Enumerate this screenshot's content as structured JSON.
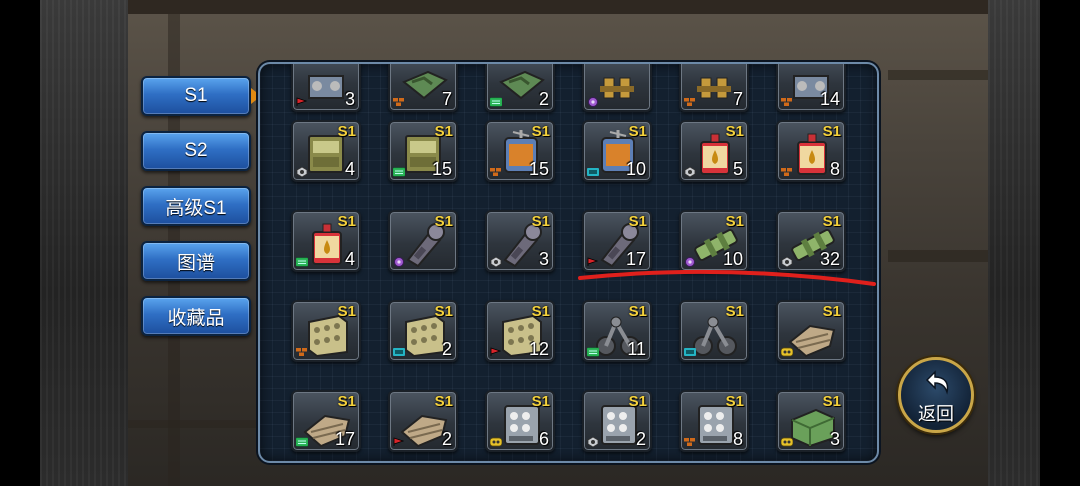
{
  "tabs": [
    {
      "label": "S1",
      "active": true
    },
    {
      "label": "S2",
      "active": false
    },
    {
      "label": "高级S1",
      "active": false
    },
    {
      "label": "图谱",
      "active": false
    },
    {
      "label": "收藏品",
      "active": false
    }
  ],
  "tier_label": "S1",
  "items": [
    {
      "icon": "engine-part-icon",
      "count": "3",
      "badge": "red-flag",
      "has_tier": false
    },
    {
      "icon": "camo-plate-icon",
      "count": "7",
      "badge": "orange-bricks",
      "has_tier": false
    },
    {
      "icon": "camo-plate-icon",
      "count": "2",
      "badge": "green-panel",
      "has_tier": false
    },
    {
      "icon": "brass-valves-icon",
      "count": "",
      "badge": "purple-gear",
      "has_tier": false
    },
    {
      "icon": "brass-valves-icon",
      "count": "7",
      "badge": "orange-bricks",
      "has_tier": false
    },
    {
      "icon": "engine-part-icon",
      "count": "14",
      "badge": "orange-bricks",
      "has_tier": false
    },
    {
      "icon": "armor-crate-icon",
      "count": "4",
      "badge": "gray-nut",
      "has_tier": true
    },
    {
      "icon": "armor-crate-icon",
      "count": "15",
      "badge": "green-panel",
      "has_tier": true
    },
    {
      "icon": "fuel-core-icon",
      "count": "15",
      "badge": "orange-bricks",
      "has_tier": true
    },
    {
      "icon": "fuel-core-icon",
      "count": "10",
      "badge": "teal-panel",
      "has_tier": true
    },
    {
      "icon": "oil-can-icon",
      "count": "5",
      "badge": "gray-nut",
      "has_tier": true
    },
    {
      "icon": "oil-can-icon",
      "count": "8",
      "badge": "orange-bricks",
      "has_tier": true
    },
    {
      "icon": "oil-can-icon",
      "count": "4",
      "badge": "green-panel",
      "has_tier": true
    },
    {
      "icon": "drive-shaft-icon",
      "count": "",
      "badge": "purple-gear",
      "has_tier": true
    },
    {
      "icon": "drive-shaft-icon",
      "count": "3",
      "badge": "gray-nut",
      "has_tier": true
    },
    {
      "icon": "drive-shaft-icon",
      "count": "17",
      "badge": "red-flag",
      "has_tier": true
    },
    {
      "icon": "green-pipe-icon",
      "count": "10",
      "badge": "purple-gear",
      "has_tier": true
    },
    {
      "icon": "green-pipe-icon",
      "count": "32",
      "badge": "gray-nut",
      "has_tier": true
    },
    {
      "icon": "concrete-block-icon",
      "count": "",
      "badge": "orange-bricks",
      "has_tier": true
    },
    {
      "icon": "concrete-block-icon",
      "count": "2",
      "badge": "teal-panel",
      "has_tier": true
    },
    {
      "icon": "concrete-block-icon",
      "count": "12",
      "badge": "red-flag",
      "has_tier": true
    },
    {
      "icon": "suspension-icon",
      "count": "11",
      "badge": "green-panel",
      "has_tier": true
    },
    {
      "icon": "suspension-icon",
      "count": "",
      "badge": "teal-panel",
      "has_tier": true
    },
    {
      "icon": "tank-track-icon",
      "count": "",
      "badge": "yellow-wheel",
      "has_tier": true
    },
    {
      "icon": "tank-track-icon",
      "count": "17",
      "badge": "green-panel",
      "has_tier": true
    },
    {
      "icon": "tank-track-icon",
      "count": "2",
      "badge": "red-flag",
      "has_tier": true
    },
    {
      "icon": "launcher-pod-icon",
      "count": "6",
      "badge": "yellow-wheel",
      "has_tier": true
    },
    {
      "icon": "launcher-pod-icon",
      "count": "2",
      "badge": "gray-nut",
      "has_tier": true
    },
    {
      "icon": "launcher-pod-icon",
      "count": "8",
      "badge": "orange-bricks",
      "has_tier": true
    },
    {
      "icon": "green-armor-plate-icon",
      "count": "3",
      "badge": "yellow-wheel",
      "has_tier": true
    }
  ],
  "back_button": {
    "label": "返回"
  },
  "colors": {
    "active_tab": "#f7a21f",
    "tab": "#2f6fc4",
    "tier": "#f5d23c",
    "annotation": "#e0201c"
  }
}
